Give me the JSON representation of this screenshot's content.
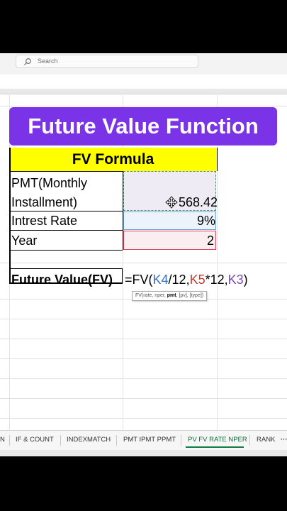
{
  "search": {
    "placeholder": "Search"
  },
  "banner": {
    "title": "Future Value Function"
  },
  "table": {
    "header": "FV Formula",
    "pmt_label_line1": "PMT(Monthly",
    "pmt_label_line2": "Installment)",
    "pmt_value": "568.42",
    "rate_label": "Intrest Rate",
    "rate_value": "9%",
    "year_label": "Year",
    "year_value": "2",
    "fv_label": "Future Value(FV)"
  },
  "formula": {
    "prefix": "=FV(",
    "ref1": "K4",
    "part2": "/12,",
    "ref2": "K5",
    "part3": "*12,",
    "ref3": "K3",
    "suffix": ")"
  },
  "tooltip": {
    "prefix": "FV(rate, nper, ",
    "bold": "pmt",
    "suffix": ", [pv], [type])"
  },
  "tabs": [
    {
      "label": "N"
    },
    {
      "label": "IF & COUNT"
    },
    {
      "label": "INDEXMATCH"
    },
    {
      "label": "PMT IPMT PPMT"
    },
    {
      "label": "PV FV RATE NPER"
    },
    {
      "label": "RANK"
    },
    {
      "label": "···"
    }
  ],
  "colors": {
    "banner": "#7a33e6",
    "header": "#ffff00",
    "ref_blue": "#3a6fbf",
    "ref_red": "#c43a2f",
    "ref_purple": "#7a4ab5",
    "active_tab": "#107c41"
  }
}
